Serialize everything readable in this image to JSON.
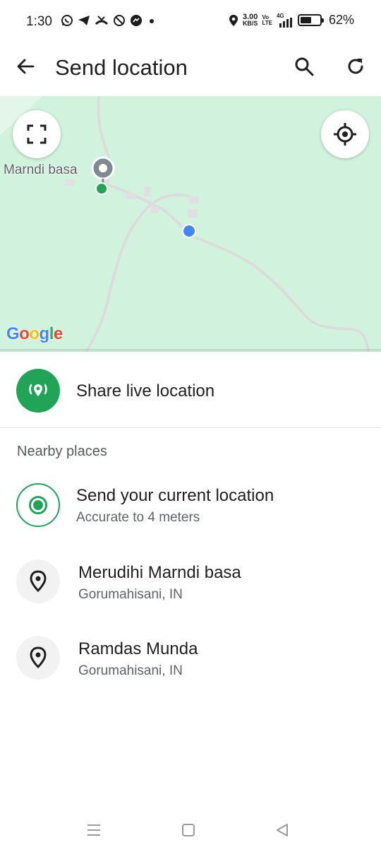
{
  "status_bar": {
    "time": "1:30",
    "net_speed_value": "3.00",
    "net_speed_unit": "KB/S",
    "volte_top": "Vo",
    "volte_bottom": "LTE",
    "network_type": "4G",
    "battery_percent": "62%",
    "battery_level": 0.62,
    "icons": [
      "whatsapp-icon",
      "telegram-icon",
      "missed-call-icon",
      "vpn-icon",
      "messenger-icon",
      "more-notifications-dot",
      "location-icon",
      "signal-icon",
      "battery-icon"
    ]
  },
  "app_bar": {
    "title": "Send location",
    "icons": [
      "back-arrow-icon",
      "search-icon",
      "refresh-icon"
    ]
  },
  "map": {
    "place_label": "Marndi basa",
    "attribution": [
      "G",
      "o",
      "o",
      "g",
      "l",
      "e"
    ],
    "colors": {
      "land": "#d1f3dd",
      "road": "#dcdcdc",
      "user_dot": "#4285f4",
      "pin": "#7d8a93",
      "pin_anchor": "#22a458"
    },
    "icons": [
      "fullscreen-icon",
      "my-location-icon"
    ]
  },
  "live_location": {
    "label": "Share live location",
    "icon": "live-location-icon",
    "accent": "#22a458"
  },
  "nearby": {
    "header": "Nearby places",
    "current": {
      "title": "Send your current location",
      "subtitle": "Accurate to 4 meters"
    },
    "places": [
      {
        "title": "Merudihi Marndi basa",
        "subtitle": "Gorumahisani, IN"
      },
      {
        "title": "Ramdas Munda",
        "subtitle": "Gorumahisani, IN"
      }
    ]
  },
  "nav_bar": {
    "icons": [
      "recents-icon",
      "home-icon",
      "back-icon"
    ]
  }
}
